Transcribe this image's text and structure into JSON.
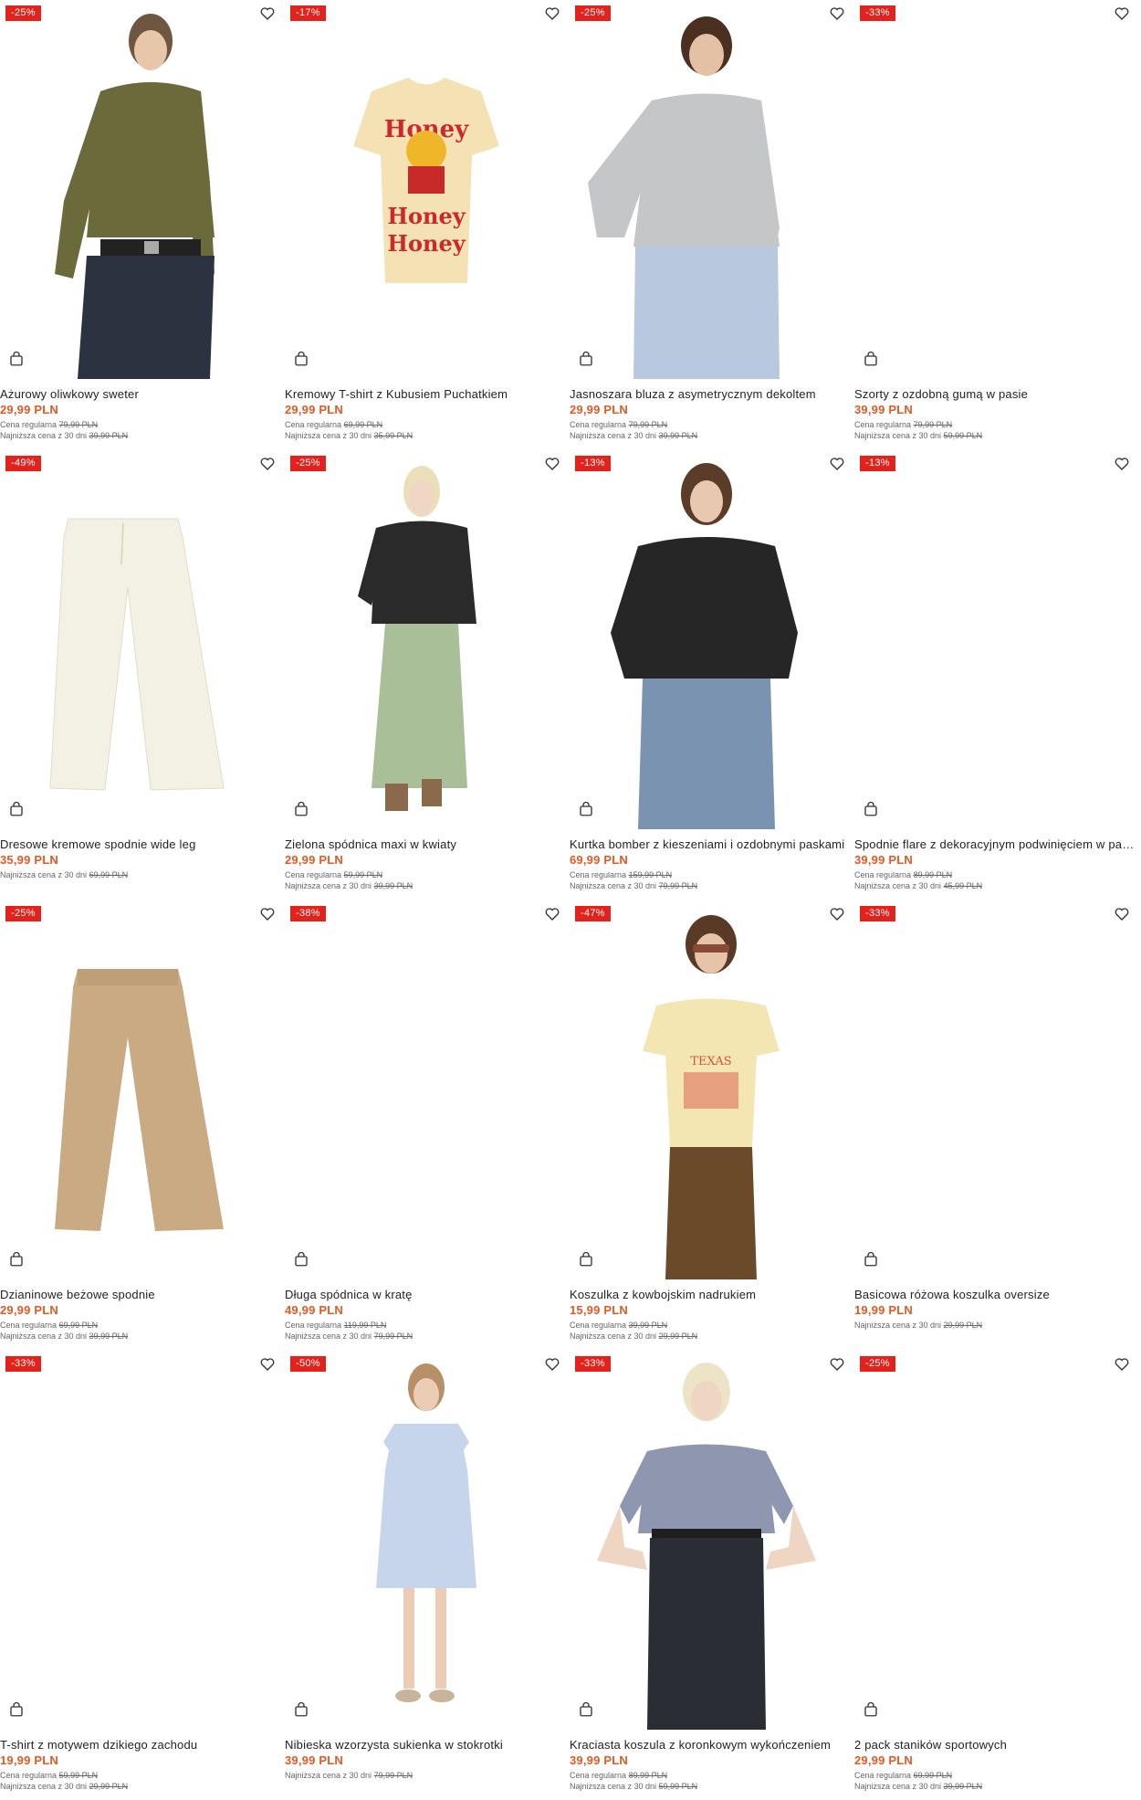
{
  "colors": {
    "badge": "#e4221c",
    "price": "#e25a24",
    "text": "#222222",
    "muted": "#666666"
  },
  "icons": {
    "favorite": "heart-outline-icon",
    "cart": "shopping-bag-icon"
  },
  "products": [
    {
      "badge": "-25%",
      "name": "Ażurowy oliwkowy sweter",
      "price": "29,99 PLN",
      "regular_label": "Cena regularna",
      "regular_price": "79,99 PLN",
      "lowest_label": "Najniższa cena z 30 dni",
      "lowest_price": "39,99 PLN"
    },
    {
      "badge": "-17%",
      "name": "Kremowy T-shirt z Kubusiem Puchatkiem",
      "price": "29,99 PLN",
      "regular_label": "Cena regularna",
      "regular_price": "69,99 PLN",
      "lowest_label": "Najniższa cena z 30 dni",
      "lowest_price": "35,99 PLN"
    },
    {
      "badge": "-25%",
      "name": "Jasnoszara bluza z asymetrycznym dekoltem",
      "price": "29,99 PLN",
      "regular_label": "Cena regularna",
      "regular_price": "79,99 PLN",
      "lowest_label": "Najniższa cena z 30 dni",
      "lowest_price": "39,99 PLN"
    },
    {
      "badge": "-33%",
      "name": "Szorty z ozdobną gumą w pasie",
      "price": "39,99 PLN",
      "regular_label": "Cena regularna",
      "regular_price": "79,99 PLN",
      "lowest_label": "Najniższa cena z 30 dni",
      "lowest_price": "59,99 PLN"
    },
    {
      "badge": "-49%",
      "name": "Dresowe kremowe spodnie wide leg",
      "price": "35,99 PLN",
      "regular_label": "",
      "regular_price": "",
      "lowest_label": "Najniższa cena z 30 dni",
      "lowest_price": "69,99 PLN"
    },
    {
      "badge": "-25%",
      "name": "Zielona spódnica maxi w kwiaty",
      "price": "29,99 PLN",
      "regular_label": "Cena regularna",
      "regular_price": "59,99 PLN",
      "lowest_label": "Najniższa cena z 30 dni",
      "lowest_price": "39,99 PLN"
    },
    {
      "badge": "-13%",
      "name": "Kurtka bomber z kieszeniami i ozdobnymi paskami",
      "price": "69,99 PLN",
      "regular_label": "Cena regularna",
      "regular_price": "159,99 PLN",
      "lowest_label": "Najniższa cena z 30 dni",
      "lowest_price": "79,99 PLN"
    },
    {
      "badge": "-13%",
      "name": "Spodnie flare z dekoracyjnym podwinięciem w pasie",
      "price": "39,99 PLN",
      "regular_label": "Cena regularna",
      "regular_price": "89,99 PLN",
      "lowest_label": "Najniższa cena z 30 dni",
      "lowest_price": "45,99 PLN"
    },
    {
      "badge": "-25%",
      "name": "Dzianinowe beżowe spodnie",
      "price": "29,99 PLN",
      "regular_label": "Cena regularna",
      "regular_price": "69,99 PLN",
      "lowest_label": "Najniższa cena z 30 dni",
      "lowest_price": "39,99 PLN"
    },
    {
      "badge": "-38%",
      "name": "Długa spódnica w kratę",
      "price": "49,99 PLN",
      "regular_label": "Cena regularna",
      "regular_price": "119,99 PLN",
      "lowest_label": "Najniższa cena z 30 dni",
      "lowest_price": "79,99 PLN"
    },
    {
      "badge": "-47%",
      "name": "Koszulka z kowbojskim nadrukiem",
      "price": "15,99 PLN",
      "regular_label": "Cena regularna",
      "regular_price": "39,99 PLN",
      "lowest_label": "Najniższa cena z 30 dni",
      "lowest_price": "29,99 PLN"
    },
    {
      "badge": "-33%",
      "name": "Basicowa różowa koszulka oversize",
      "price": "19,99 PLN",
      "regular_label": "",
      "regular_price": "",
      "lowest_label": "Najniższa cena z 30 dni",
      "lowest_price": "29,99 PLN"
    },
    {
      "badge": "-33%",
      "name": "T-shirt z motywem dzikiego zachodu",
      "price": "19,99 PLN",
      "regular_label": "Cena regularna",
      "regular_price": "59,99 PLN",
      "lowest_label": "Najniższa cena z 30 dni",
      "lowest_price": "29,99 PLN"
    },
    {
      "badge": "-50%",
      "name": "Nibieska wzorzysta sukienka w stokrotki",
      "price": "39,99 PLN",
      "regular_label": "",
      "regular_price": "",
      "lowest_label": "Najniższa cena z 30 dni",
      "lowest_price": "79,99 PLN"
    },
    {
      "badge": "-33%",
      "name": "Kraciasta koszula z koronkowym wykończeniem",
      "price": "39,99 PLN",
      "regular_label": "Cena regularna",
      "regular_price": "89,99 PLN",
      "lowest_label": "Najniższa cena z 30 dni",
      "lowest_price": "59,99 PLN"
    },
    {
      "badge": "-25%",
      "name": "2 pack staników sportowych",
      "price": "29,99 PLN",
      "regular_label": "Cena regularna",
      "regular_price": "69,99 PLN",
      "lowest_label": "Najniższa cena z 30 dni",
      "lowest_price": "39,99 PLN"
    }
  ]
}
